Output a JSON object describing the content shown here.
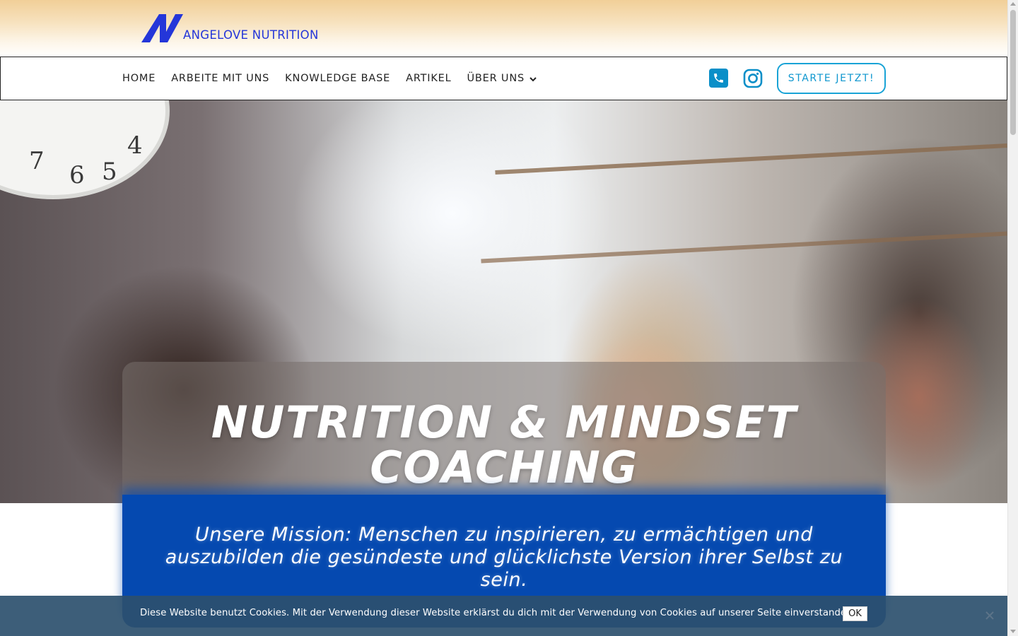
{
  "brand": {
    "logo_text": "ANGELOVE NUTRITION",
    "logo_color": "#2436d9"
  },
  "nav": {
    "items": [
      {
        "label": "HOME"
      },
      {
        "label": "ARBEITE MIT UNS"
      },
      {
        "label": "KNOWLEDGE BASE"
      },
      {
        "label": "ARTIKEL"
      },
      {
        "label": "ÜBER UNS",
        "has_dropdown": true
      }
    ],
    "icons": [
      "phone-icon",
      "instagram-icon"
    ],
    "cta_label": "STARTE JETZT!",
    "accent_color": "#19a3d6"
  },
  "hero": {
    "headline_line1": "NUTRITION & MINDSET",
    "headline_line2": "COACHING",
    "mission": "Unsere Mission: Menschen zu inspirieren, zu ermächtigen und auszubilden die gesündeste und glücklichste Version ihrer Selbst zu sein.",
    "mission_bg": "#0549b0"
  },
  "cookie_bar": {
    "text": "Diese Website benutzt Cookies. Mit der Verwendung dieser Website erklärst du dich mit der Verwendung von Cookies auf unserer Seite einverstanden.",
    "ok_label": "OK"
  }
}
